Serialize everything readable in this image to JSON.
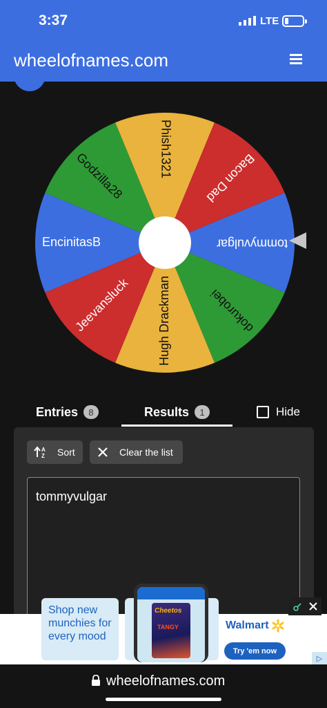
{
  "status": {
    "time": "3:37",
    "network": "LTE"
  },
  "header": {
    "site": "wheelofnames.com",
    "menu_icon": "hamburger-icon"
  },
  "wheel": {
    "segments": [
      {
        "label": "Phish1321",
        "color": "#e9b33d"
      },
      {
        "label": "Bacon Dad",
        "color": "#cc2d2d"
      },
      {
        "label": "tommyvulgar",
        "color": "#3d6ee0"
      },
      {
        "label": "dokurobei",
        "color": "#2e9a36"
      },
      {
        "label": "Hugh Drackman",
        "color": "#e9b33d"
      },
      {
        "label": "Jeevansluck",
        "color": "#cc2d2d"
      },
      {
        "label": "EncinitasB",
        "color": "#3d6ee0"
      },
      {
        "label": "Godzilla28",
        "color": "#2e9a36"
      }
    ]
  },
  "tabs": {
    "entries": {
      "label": "Entries",
      "count": "8"
    },
    "results": {
      "label": "Results",
      "count": "1"
    },
    "hide_label": "Hide"
  },
  "panel": {
    "sort_label": "Sort",
    "clear_label": "Clear the list",
    "results_text": "tommyvulgar"
  },
  "ad": {
    "tagline": "Shop new munchies for every mood",
    "product_brand": "Cheetos",
    "product_flavor": "TANGY",
    "advertiser": "Walmart",
    "cta": "Try 'em now"
  },
  "browser": {
    "url": "wheelofnames.com"
  },
  "colors": {
    "accent": "#3d6ee0",
    "background": "#141414",
    "panel": "#2b2b2b"
  }
}
